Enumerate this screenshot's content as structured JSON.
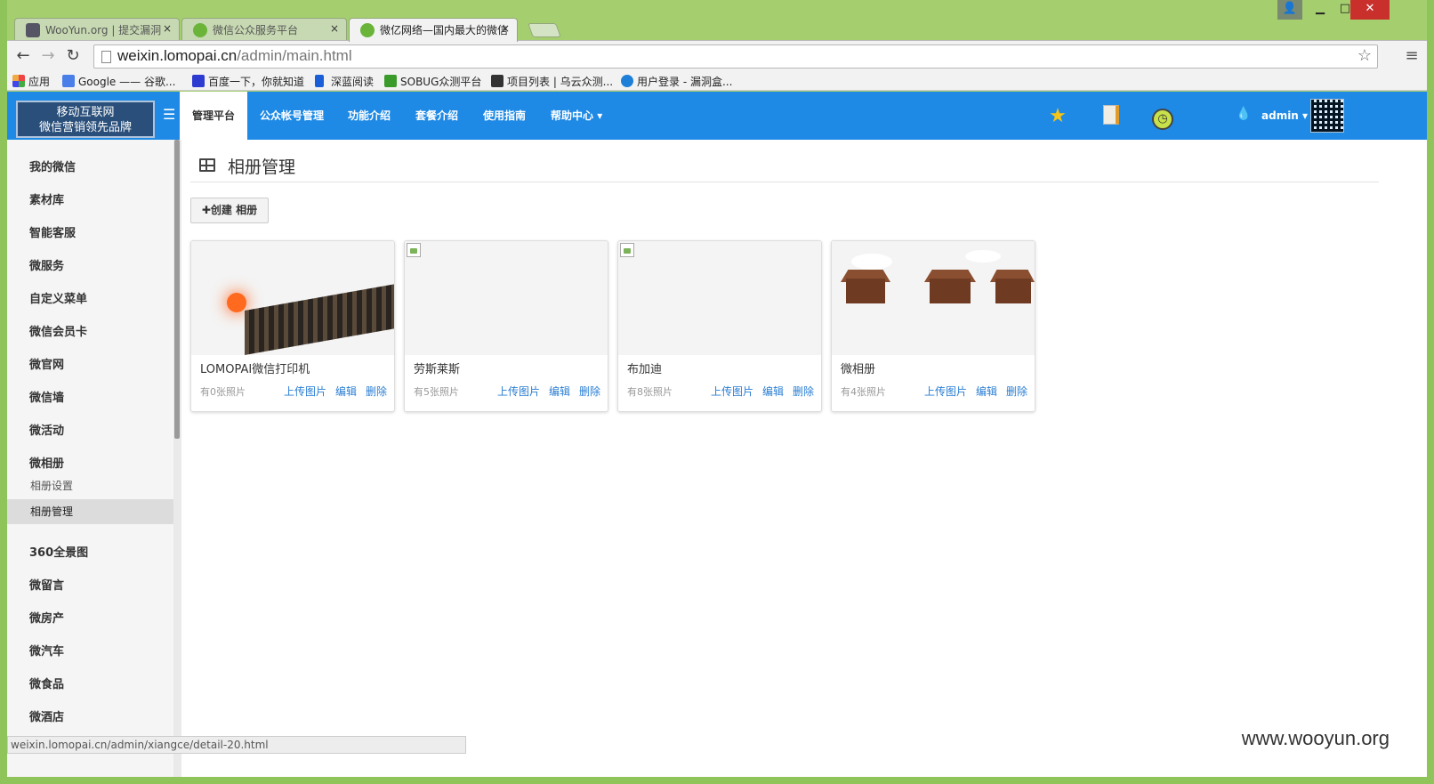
{
  "browser": {
    "tabs": [
      {
        "title": "WooYun.org | 提交漏洞",
        "active": false
      },
      {
        "title": "微信公众服务平台",
        "active": false
      },
      {
        "title": "微亿网络—国内最大的微信",
        "active": true
      }
    ],
    "url_host": "weixin.lomopai.cn",
    "url_path": "/admin/main.html",
    "bookmarks": [
      "应用",
      "Google —— 谷歌...",
      "百度一下，你就知道",
      "深蓝阅读",
      "SOBUG众测平台",
      "项目列表 | 乌云众测...",
      "用户登录 - 漏洞盒..."
    ],
    "status_url": "weixin.lomopai.cn/admin/xiangce/detail-20.html"
  },
  "header": {
    "logo_line1": "移动互联网",
    "logo_line2": "微信营销领先品牌",
    "nav": [
      "管理平台",
      "公众帐号管理",
      "功能介绍",
      "套餐介绍",
      "使用指南",
      "帮助中心"
    ],
    "help_caret": "▾",
    "user": "admin"
  },
  "sidebar": {
    "items_top": [
      "我的微信",
      "素材库",
      "智能客服",
      "微服务",
      "自定义菜单",
      "微信会员卡",
      "微官网",
      "微信墙",
      "微活动",
      "微相册"
    ],
    "subitems": [
      "相册设置",
      "相册管理"
    ],
    "items_bottom": [
      "360全景图",
      "微留言",
      "微房产",
      "微汽车",
      "微食品",
      "微酒店"
    ]
  },
  "main": {
    "title": "相册管理",
    "create_button": "✚创建 相册",
    "albums": [
      {
        "name": "LOMOPAI微信打印机",
        "count": "有0张照片",
        "image": "sunset"
      },
      {
        "name": "劳斯莱斯",
        "count": "有5张照片",
        "image": "broken"
      },
      {
        "name": "布加迪",
        "count": "有8张照片",
        "image": "broken"
      },
      {
        "name": "微相册",
        "count": "有4张照片",
        "image": "lagoon"
      }
    ],
    "actions": {
      "upload": "上传图片",
      "edit": "编辑",
      "delete": "删除"
    }
  },
  "watermark": "www.wooyun.org",
  "colors": {
    "nav_bg": "#1e8ae6",
    "link": "#2a7ed3",
    "frame": "#a5cf6e"
  }
}
